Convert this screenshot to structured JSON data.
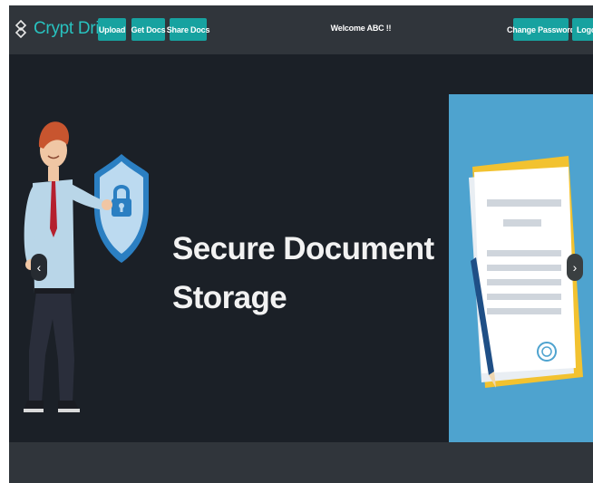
{
  "brand": {
    "name": "Crypt Drive",
    "logo_icon": "diamond-link-icon"
  },
  "nav": {
    "upload_label": "Upload",
    "get_docs_label": "Get Docs",
    "share_docs_label": "Share Docs",
    "welcome_text": "Welcome ABC !!",
    "change_password_label": "Change Password",
    "logout_label": "Logout"
  },
  "carousel": {
    "headline_line1": "Secure Document",
    "headline_line2": "Storage",
    "prev_icon": "chevron-left-icon",
    "next_icon": "chevron-right-icon",
    "prev_glyph": "‹",
    "next_glyph": "›"
  },
  "colors": {
    "accent": "#17a2a0",
    "brand_text": "#28c2bf",
    "navbar": "#30353b",
    "background": "#1b2027",
    "slide_panel": "#4ea3cf"
  }
}
